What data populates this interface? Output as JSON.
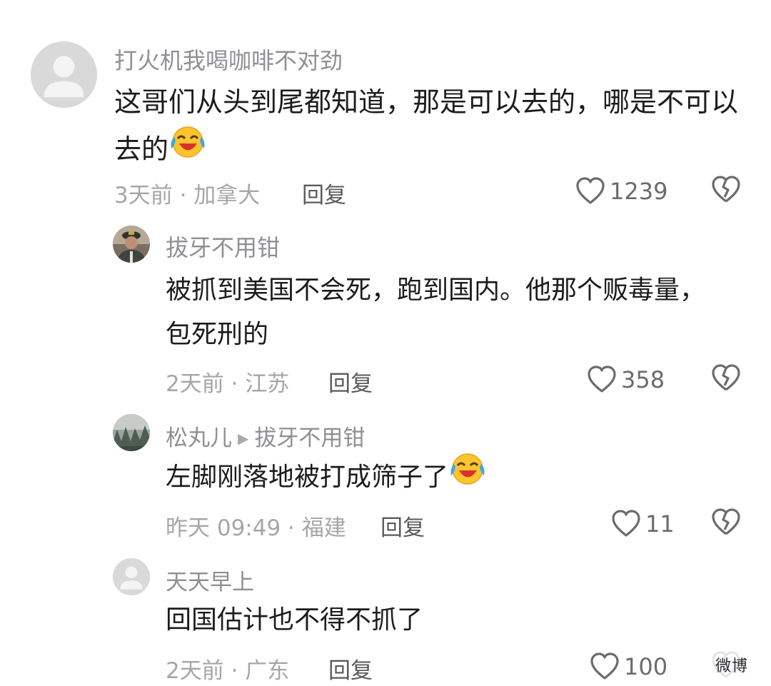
{
  "comments": [
    {
      "username": "打火机我喝咖啡不对劲",
      "line1": "这哥们从头到尾都知道，那是可以去的，哪是不可以",
      "line2": "去的",
      "meta": "3天前 · 加拿大",
      "reply_label": "回复",
      "likes": "1239",
      "avatar": "default-avatar",
      "emoji": "crying-laughing-emoji"
    },
    {
      "username": "拔牙不用钳",
      "line1": "被抓到美国不会死，跑到国内。他那个贩毒量，",
      "line2": "包死刑的",
      "meta": "2天前 · 江苏",
      "reply_label": "回复",
      "likes": "358",
      "avatar": "military-officer-photo"
    },
    {
      "username": "松丸儿",
      "reply_to": "拔牙不用钳",
      "line1": "左脚刚落地被打成筛子了",
      "meta": "昨天 09:49 · 福建",
      "reply_label": "回复",
      "likes": "11",
      "avatar": "foggy-forest-photo",
      "emoji": "crying-laughing-emoji"
    },
    {
      "username": "天天早上",
      "line1": "回国估计也不得不抓了",
      "meta": "2天前 · 广东",
      "reply_label": "回复",
      "likes": "100",
      "avatar": "default-avatar"
    }
  ],
  "icons": {
    "like": "heart-outline-icon",
    "dislike": "broken-heart-icon"
  },
  "colors": {
    "username": "#8f8f94",
    "content": "#1c1c1e",
    "meta": "#a6a6aa",
    "reply": "#5a5a5f"
  },
  "watermark": "微博"
}
